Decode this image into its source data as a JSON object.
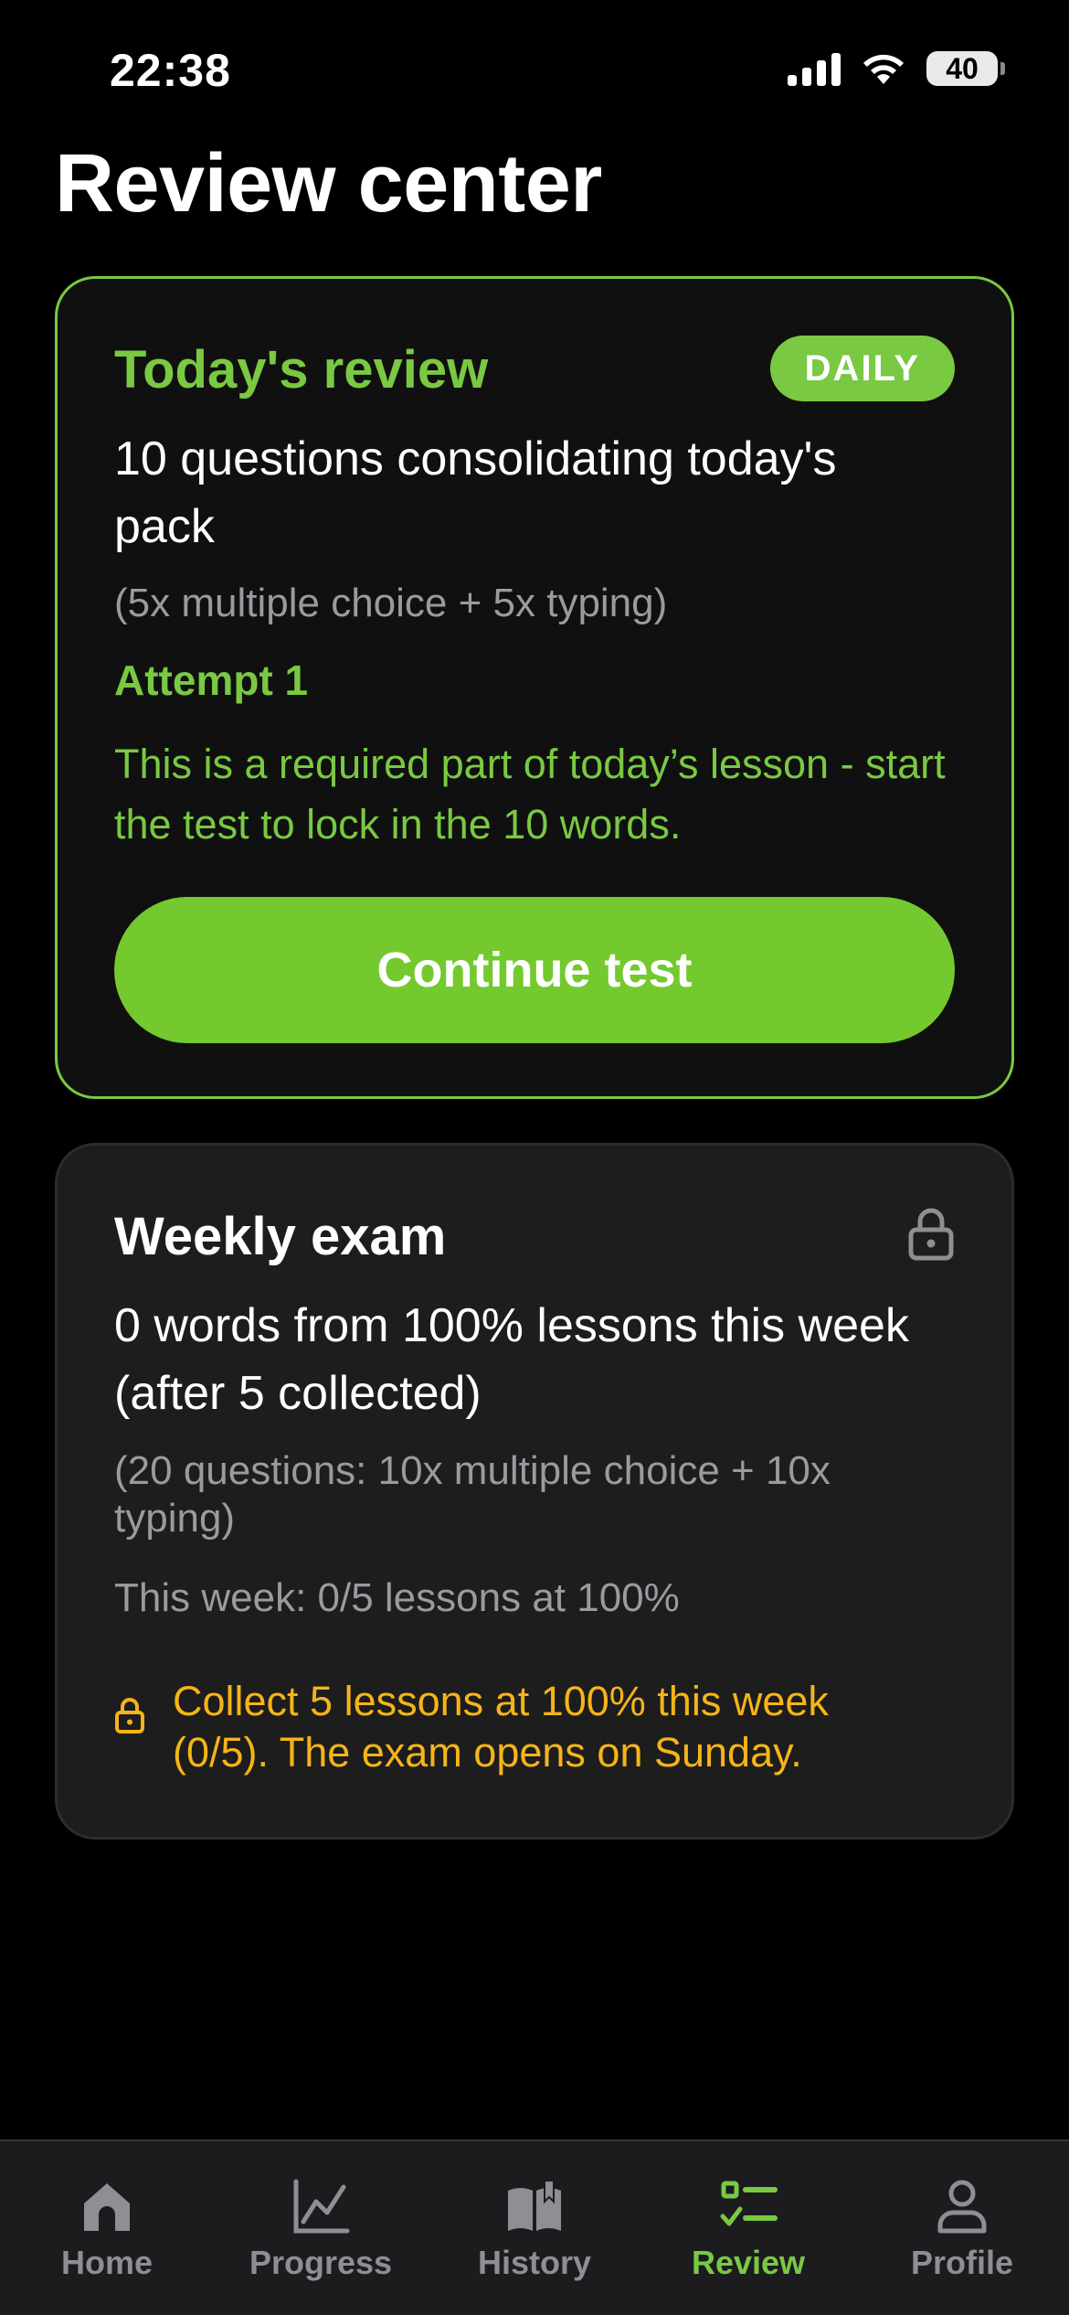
{
  "status_bar": {
    "time": "22:38",
    "battery": "40"
  },
  "page": {
    "title": "Review center"
  },
  "daily_card": {
    "title": "Today's review",
    "badge": "DAILY",
    "description": "10 questions consolidating today's pack",
    "subtext": "(5x multiple choice + 5x typing)",
    "attempt": "Attempt 1",
    "note": "This is a required part of today’s lesson - start the test to lock in the 10 words.",
    "button_label": "Continue test"
  },
  "weekly_card": {
    "title": "Weekly exam",
    "description": "0 words from 100% lessons this week (after 5 collected)",
    "subtext": "(20 questions: 10x multiple choice + 10x typing)",
    "progress": "This week: 0/5 lessons at 100%",
    "warning": "Collect 5 lessons at 100% this week (0/5). The exam opens on Sunday."
  },
  "tab_bar": {
    "items": [
      {
        "label": "Home",
        "icon": "home-icon"
      },
      {
        "label": "Progress",
        "icon": "chart-icon"
      },
      {
        "label": "History",
        "icon": "book-icon"
      },
      {
        "label": "Review",
        "icon": "checklist-icon",
        "active": true
      },
      {
        "label": "Profile",
        "icon": "person-icon"
      }
    ]
  },
  "colors": {
    "accent_green": "#79c942",
    "warning_yellow": "#f5b418",
    "inactive_gray": "#8e8e93"
  }
}
